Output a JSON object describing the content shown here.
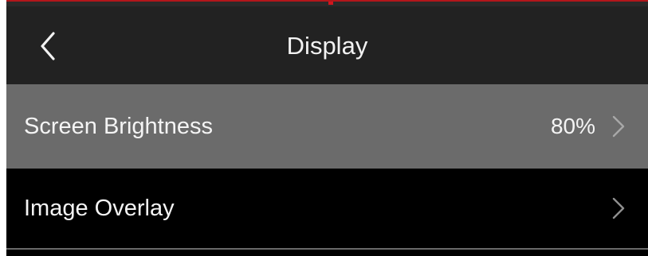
{
  "header": {
    "title": "Display",
    "back_icon": "chevron-left-icon"
  },
  "settings": {
    "items": [
      {
        "label": "Screen Brightness",
        "value": "80%",
        "icon": "chevron-right-icon",
        "selected": true
      },
      {
        "label": "Image Overlay",
        "value": "",
        "icon": "chevron-right-icon",
        "selected": false
      }
    ]
  },
  "colors": {
    "header_bg": "#222222",
    "selected_row_bg": "#6b6b6b",
    "row_bg": "#000000",
    "accent_red": "#d0171e",
    "text": "#f4f4f4",
    "chevron": "#9a9a9a"
  }
}
